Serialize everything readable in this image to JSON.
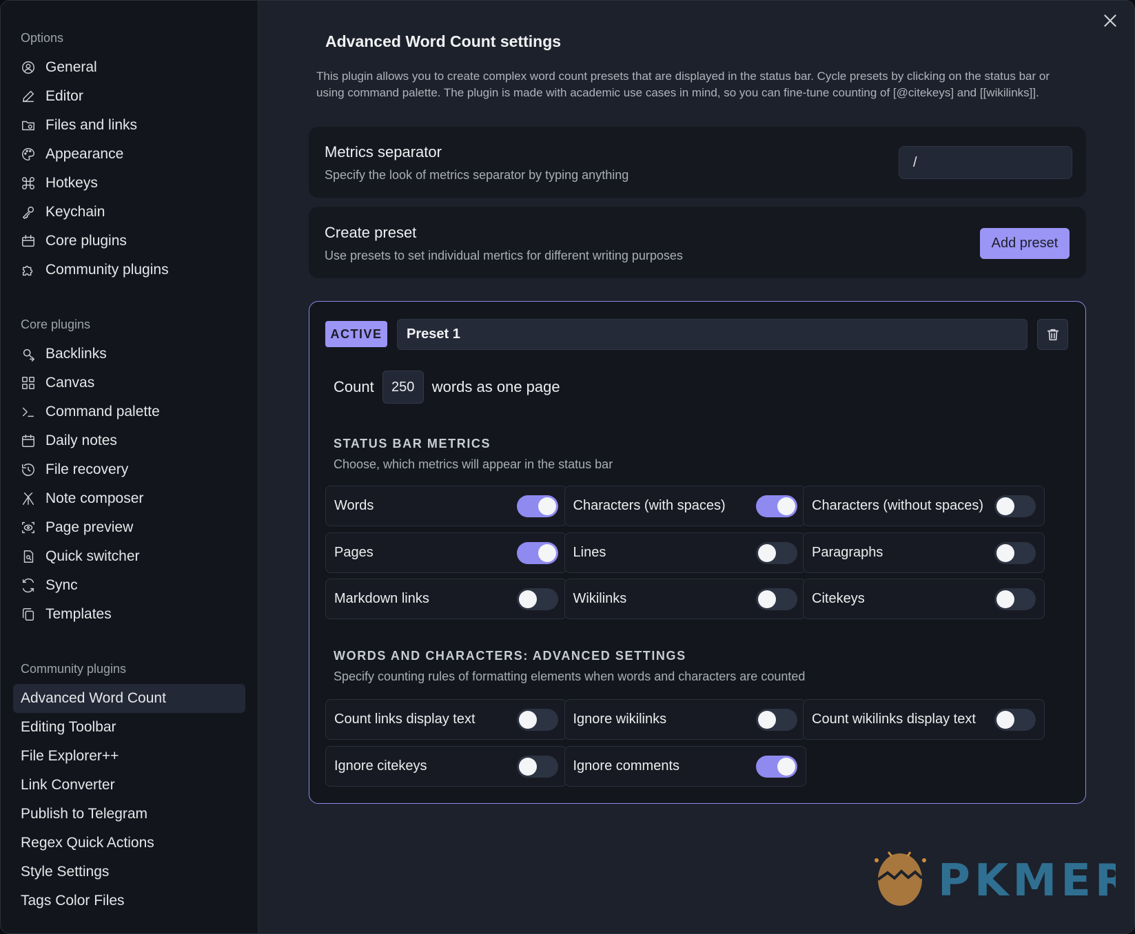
{
  "sidebar": {
    "options_title": "Options",
    "options": [
      {
        "label": "General",
        "icon": "user-circle-icon"
      },
      {
        "label": "Editor",
        "icon": "pencil-icon"
      },
      {
        "label": "Files and links",
        "icon": "folder-icon"
      },
      {
        "label": "Appearance",
        "icon": "palette-icon"
      },
      {
        "label": "Hotkeys",
        "icon": "command-icon"
      },
      {
        "label": "Keychain",
        "icon": "key-icon"
      },
      {
        "label": "Core plugins",
        "icon": "calendar-box-icon"
      },
      {
        "label": "Community plugins",
        "icon": "puzzle-icon"
      }
    ],
    "core_title": "Core plugins",
    "core": [
      {
        "label": "Backlinks",
        "icon": "backlinks-icon"
      },
      {
        "label": "Canvas",
        "icon": "grid-icon"
      },
      {
        "label": "Command palette",
        "icon": "terminal-icon"
      },
      {
        "label": "Daily notes",
        "icon": "calendar-icon"
      },
      {
        "label": "File recovery",
        "icon": "history-icon"
      },
      {
        "label": "Note composer",
        "icon": "merge-icon"
      },
      {
        "label": "Page preview",
        "icon": "scan-eye-icon"
      },
      {
        "label": "Quick switcher",
        "icon": "file-search-icon"
      },
      {
        "label": "Sync",
        "icon": "sync-icon"
      },
      {
        "label": "Templates",
        "icon": "copy-icon"
      }
    ],
    "community_title": "Community plugins",
    "community": [
      "Advanced Word Count",
      "Editing Toolbar",
      "File Explorer++",
      "Link Converter",
      "Publish to Telegram",
      "Regex Quick Actions",
      "Style Settings",
      "Tags Color Files"
    ]
  },
  "main": {
    "title": "Advanced Word Count settings",
    "description": "This plugin allows you to create complex word count presets that are displayed in the status bar. Cycle presets by clicking on the status bar or using command palette. The plugin is made with academic use cases in mind, so you can fine-tune counting of [@citekeys] and [[wikilinks]].",
    "separator": {
      "title": "Metrics separator",
      "sub": "Specify the look of metrics separator by typing anything",
      "value": "/"
    },
    "create": {
      "title": "Create preset",
      "sub": "Use presets to set individual mertics for different writing purposes",
      "button": "Add preset"
    },
    "preset": {
      "badge": "ACTIVE",
      "name": "Preset 1",
      "count_label": "Count",
      "count_value": "250",
      "count_suffix": "words as one page",
      "metrics_title": "STATUS BAR METRICS",
      "metrics_sub": "Choose, which metrics will appear in the status bar",
      "metrics": [
        {
          "label": "Words",
          "on": true
        },
        {
          "label": "Characters (with spaces)",
          "on": true
        },
        {
          "label": "Characters (without spaces)",
          "on": false
        },
        {
          "label": "Pages",
          "on": true
        },
        {
          "label": "Lines",
          "on": false
        },
        {
          "label": "Paragraphs",
          "on": false
        },
        {
          "label": "Markdown links",
          "on": false
        },
        {
          "label": "Wikilinks",
          "on": false
        },
        {
          "label": "Citekeys",
          "on": false
        }
      ],
      "advanced_title": "WORDS AND CHARACTERS: ADVANCED SETTINGS",
      "advanced_sub": "Specify counting rules of formatting elements when words and characters are counted",
      "advanced": [
        {
          "label": "Count links display text",
          "on": false
        },
        {
          "label": "Ignore wikilinks",
          "on": false
        },
        {
          "label": "Count wikilinks display text",
          "on": false
        },
        {
          "label": "Ignore citekeys",
          "on": false
        },
        {
          "label": "Ignore comments",
          "on": true
        }
      ]
    }
  },
  "watermark": {
    "text": "PKMER"
  },
  "colors": {
    "accent": "#9b95f5",
    "toggle_on": "#8f8af0",
    "bg": "#1d212b",
    "sidebar_bg": "#12151c"
  }
}
